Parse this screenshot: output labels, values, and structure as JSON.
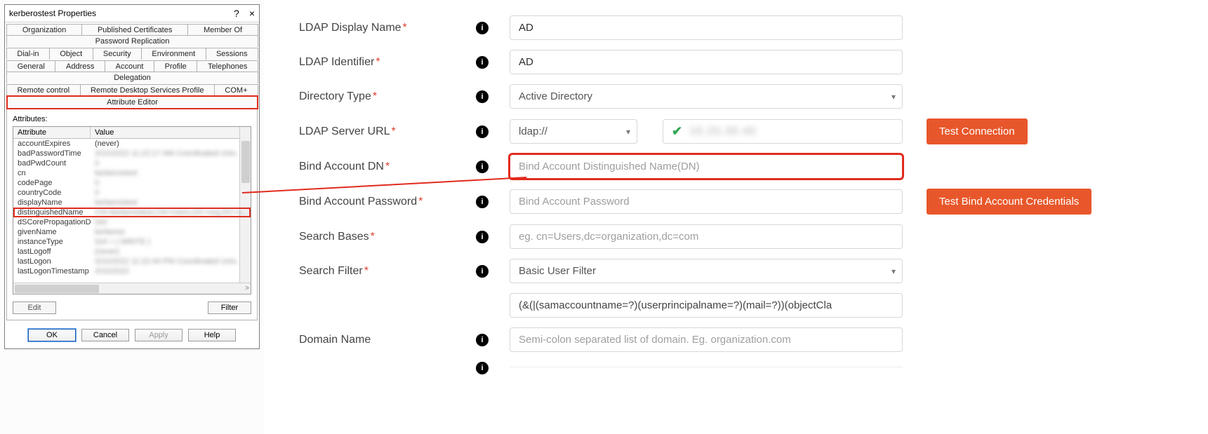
{
  "dialog": {
    "title": "kerberostest Properties",
    "help": "?",
    "close": "×",
    "tabs_row1": [
      "Organization",
      "Published Certificates",
      "Member Of",
      "Password Replication"
    ],
    "tabs_row2": [
      "Dial-in",
      "Object",
      "Security",
      "Environment",
      "Sessions"
    ],
    "tabs_row3": [
      "General",
      "Address",
      "Account",
      "Profile",
      "Telephones",
      "Delegation"
    ],
    "tabs_row4": [
      "Remote control",
      "Remote Desktop Services Profile",
      "COM+",
      "Attribute Editor"
    ],
    "attributes_label": "Attributes:",
    "head_attr": "Attribute",
    "head_val": "Value",
    "rows": [
      {
        "a": "accountExpires",
        "v": "(never)",
        "blur": false
      },
      {
        "a": "badPasswordTime",
        "v": "3/10/2022 11:22:17 AM Coordinated Univ...",
        "blur": true
      },
      {
        "a": "badPwdCount",
        "v": "0",
        "blur": true
      },
      {
        "a": "cn",
        "v": "kerberostest",
        "blur": true
      },
      {
        "a": "codePage",
        "v": "0",
        "blur": true
      },
      {
        "a": "countryCode",
        "v": "0",
        "blur": true
      },
      {
        "a": "displayName",
        "v": "kerberostest",
        "blur": true
      },
      {
        "a": "distinguishedName",
        "v": "CN=kerberostest,CN=Users,DC=org,DC=c...",
        "blur": true,
        "hl": true
      },
      {
        "a": "dSCorePropagationD...",
        "v": "0x0",
        "blur": true
      },
      {
        "a": "givenName",
        "v": "kerberos",
        "blur": true
      },
      {
        "a": "instanceType",
        "v": "0x4 = ( WRITE )",
        "blur": true
      },
      {
        "a": "lastLogoff",
        "v": "(never)",
        "blur": true
      },
      {
        "a": "lastLogon",
        "v": "3/10/2022 11:22:44 PM Coordinated Univ...",
        "blur": true
      },
      {
        "a": "lastLogonTimestamp",
        "v": "3/10/2022",
        "blur": true
      }
    ],
    "scroll_left": "<",
    "scroll_right": ">",
    "edit": "Edit",
    "filter": "Filter",
    "ok": "OK",
    "cancel": "Cancel",
    "apply": "Apply",
    "helpbtn": "Help"
  },
  "form": {
    "ldap_display_label": "LDAP Display Name",
    "ldap_display_val": "AD",
    "ldap_id_label": "LDAP Identifier",
    "ldap_id_val": "AD",
    "dir_type_label": "Directory Type",
    "dir_type_val": "Active Directory",
    "server_url_label": "LDAP Server URL",
    "server_url_scheme": "ldap://",
    "server_url_verified": "10.20.30.40",
    "test_conn": "Test Connection",
    "bind_dn_label": "Bind Account DN",
    "bind_dn_ph": "Bind Account Distinguished Name(DN)",
    "bind_pw_label": "Bind Account Password",
    "bind_pw_ph": "Bind Account Password",
    "test_creds": "Test Bind Account Credentials",
    "search_bases_label": "Search Bases",
    "search_bases_ph": "eg. cn=Users,dc=organization,dc=com",
    "search_filter_label": "Search Filter",
    "search_filter_val": "Basic User Filter",
    "filter_expr": "(&(|(samaccountname=?)(userprincipalname=?)(mail=?))(objectCla",
    "domain_label": "Domain Name",
    "domain_ph": "Semi-colon separated list of domain. Eg. organization.com"
  }
}
